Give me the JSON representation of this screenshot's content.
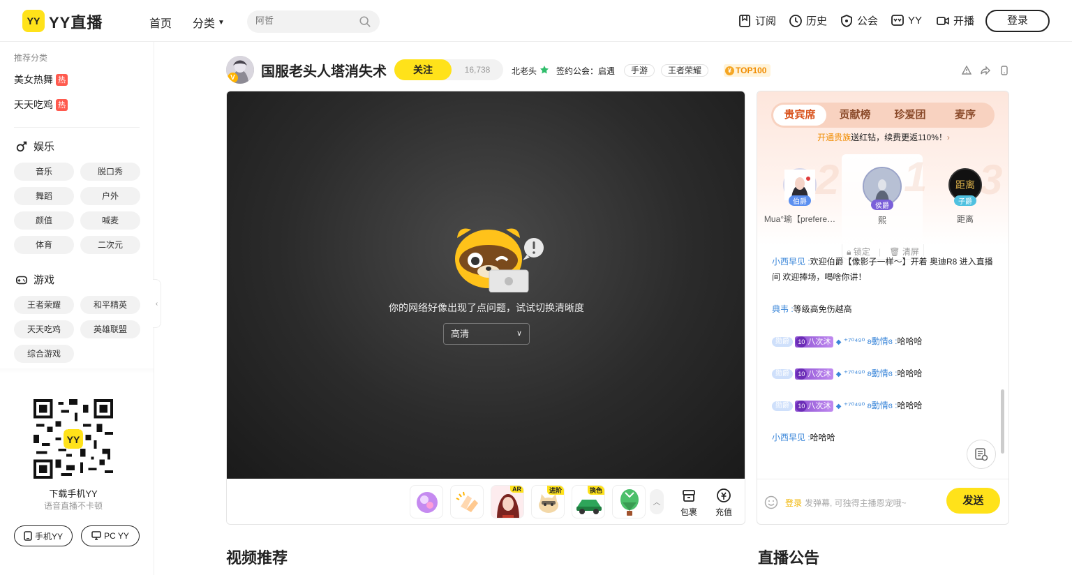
{
  "header": {
    "logo_mark": "YY",
    "logo_text": "YY直播",
    "nav": [
      "首页",
      "分类"
    ],
    "search_placeholder": "阿哲",
    "links": [
      "订阅",
      "历史",
      "公会",
      "YY",
      "开播"
    ],
    "login_label": "登录"
  },
  "sidebar": {
    "recommend_title": "推荐分类",
    "hot_items": [
      {
        "label": "美女热舞",
        "tag": "热"
      },
      {
        "label": "天天吃鸡",
        "tag": "热"
      }
    ],
    "entertainment": {
      "title": "娱乐",
      "items": [
        "音乐",
        "脱口秀",
        "舞蹈",
        "户外",
        "颜值",
        "喊麦",
        "体育",
        "二次元"
      ]
    },
    "games": {
      "title": "游戏",
      "items": [
        "王者荣耀",
        "和平精英",
        "天天吃鸡",
        "英雄联盟",
        "综合游戏"
      ]
    },
    "download_title": "下载手机YY",
    "download_sub": "语音直播不卡顿",
    "btn_mobile": "手机YY",
    "btn_pc": "PC YY"
  },
  "room": {
    "title": "国服老头人塔消失术",
    "follow_label": "关注",
    "follow_count": "16,738",
    "host": "北老头",
    "guild": "签约公会：启遇",
    "tags": [
      "手游",
      "王者荣耀"
    ],
    "rank_badge": "TOP100"
  },
  "player": {
    "error_message": "你的网络好像出现了点问题，试试切换清晰度",
    "quality": "高清",
    "gift_badges": [
      "AR",
      "进阶",
      "换色"
    ],
    "tools": [
      "包裹",
      "充值"
    ]
  },
  "panel": {
    "tabs": [
      "贵宾席",
      "贡献榜",
      "珍爱团",
      "麦序"
    ],
    "promo_highlight": "开通贵族",
    "promo_text": "送红钻，续费更返110%！",
    "vips": [
      {
        "name": "Mua°瑜【prefere…",
        "rank": "伯爵"
      },
      {
        "name": "熙",
        "rank": "侯爵"
      },
      {
        "name": "距离",
        "rank": "子爵"
      }
    ],
    "lock_label": "锁定",
    "clear_label": "清屏",
    "messages": [
      {
        "user": "小西早见 :",
        "text": "欢迎伯爵【像影子一样～】开着 奥迪R8 进入直播间 欢迎捧场，喝啥你讲！"
      },
      {
        "user": "典韦 :",
        "text": "等级高免伤越高"
      },
      {
        "noble": "勋爵",
        "fan_level": "10",
        "fan_name": "八次沐",
        "user": "⁺⁷⁰⁴⁹⁰ ʚ動情ɞ :",
        "text": "哈哈哈"
      },
      {
        "noble": "勋爵",
        "fan_level": "10",
        "fan_name": "八次沐",
        "user": "⁺⁷⁰⁴⁹⁰ ʚ動情ɞ :",
        "text": "哈哈哈"
      },
      {
        "noble": "勋爵",
        "fan_level": "10",
        "fan_name": "八次沐",
        "user": "⁺⁷⁰⁴⁹⁰ ʚ動情ɞ :",
        "text": "哈哈哈"
      },
      {
        "user": "小西早见 :",
        "text": "哈哈哈"
      }
    ],
    "input_login": "登录",
    "input_placeholder": "发弹幕, 可独得主播恩宠哦~",
    "send_label": "发送"
  },
  "sections": {
    "video_recommend": "视频推荐",
    "announcement": "直播公告"
  },
  "colors": {
    "brand_yellow": "#ffe21a",
    "link_blue": "#3a86d9",
    "hot_red": "#ff5a4e"
  }
}
